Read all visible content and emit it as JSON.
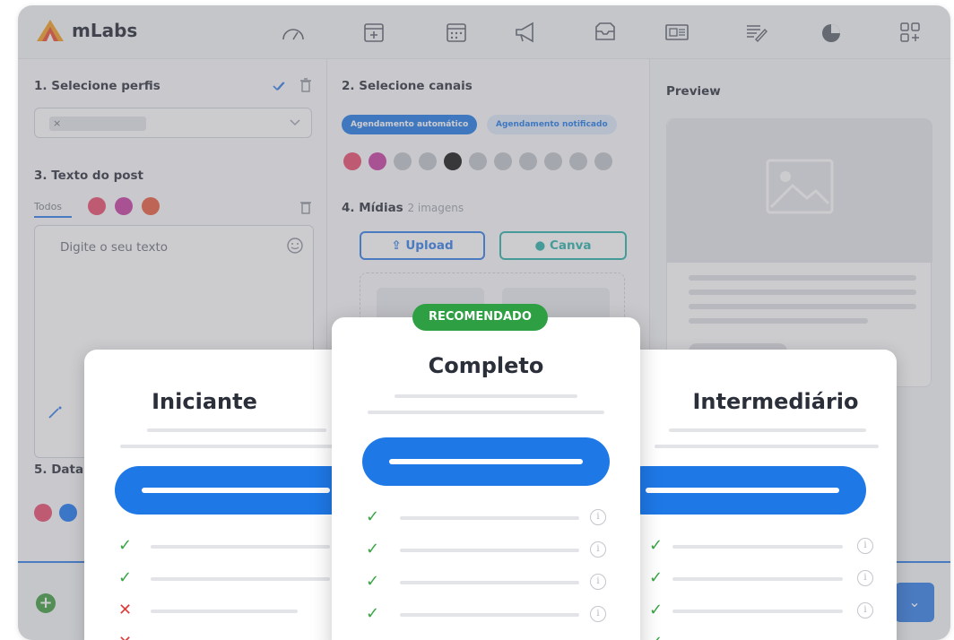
{
  "app": {
    "name": "mLabs"
  },
  "sections": {
    "profiles": "1. Selecione perfis",
    "channels": "2. Selecione canais",
    "post_text": "3. Texto do post",
    "media": "4. Mídias",
    "media_count": "2 imagens",
    "date": "5. Data",
    "preview": "Preview"
  },
  "profiles": {
    "chip_remove": "×"
  },
  "channels": {
    "auto": "Agendamento automático",
    "notified": "Agendamento notificado"
  },
  "post": {
    "tab_all": "Todos",
    "placeholder": "Digite o seu texto"
  },
  "media": {
    "upload": "Upload",
    "canva": "Canva"
  },
  "plans": {
    "badge": "RECOMENDADO",
    "basic": "Iniciante",
    "complete": "Completo",
    "mid": "Intermediário"
  },
  "colors": {
    "brand_blue": "#1e78e6",
    "recommended_green": "#2ea043",
    "check_green": "#3aa646",
    "cross_red": "#e03b3b"
  }
}
